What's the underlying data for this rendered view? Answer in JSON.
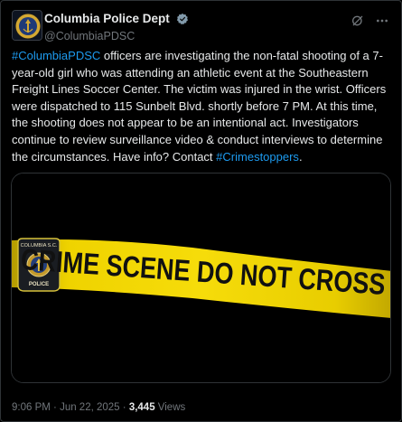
{
  "account": {
    "display_name": "Columbia Police Dept",
    "handle": "@ColumbiaPDSC",
    "verified_color": "#829aab",
    "seal_text_top": "COLUMBIA S.C.",
    "seal_text_bottom": "POLICE"
  },
  "post": {
    "hashtag_1": "#ColumbiaPDSC",
    "text_part_1": " officers are investigating the non-fatal shooting of a 7-year-old girl who was attending an athletic event at the Southeastern Freight Lines Soccer Center. The victim was injured in the wrist. Officers were dispatched to 115 Sunbelt Blvd. shortly before 7 PM. At this time, the shooting does not appear to be an intentional act. Investigators continue to review surveillance video & conduct interviews to determine the circumstances. Have info? Contact ",
    "hashtag_2": "#Crimestoppers",
    "text_part_2": "."
  },
  "media": {
    "tape_text": "CRIME SCENE DO NOT CROSS",
    "patch_text_top": "COLUMBIA S.C.",
    "patch_text_bottom": "POLICE",
    "tape_color": "#f2d800"
  },
  "meta": {
    "time": "9:06 PM",
    "sep1": " · ",
    "date": "Jun 22, 2025",
    "sep2": " · ",
    "views_count": "3,445",
    "views_label": " Views"
  },
  "icons": {
    "verified": "verified-badge-icon",
    "grok": "grok-icon",
    "more": "more-icon"
  },
  "colors": {
    "background": "#000000",
    "text": "#e7e9ea",
    "secondary": "#71767b",
    "link": "#1d9bf0"
  }
}
